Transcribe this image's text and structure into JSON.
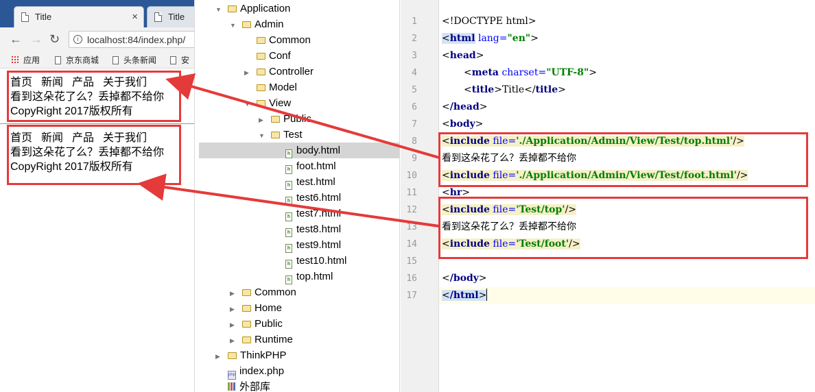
{
  "browser": {
    "tabs": [
      {
        "title": "Title",
        "close": "×"
      },
      {
        "title": "Title"
      }
    ],
    "url": "localhost:84/index.php/",
    "bookmarks": [
      "应用",
      "京东商城",
      "头条新闻",
      "安"
    ],
    "page_blocks": [
      {
        "nav": [
          "首页",
          "新闻",
          "产品",
          "关于我们"
        ],
        "text": "看到这朵花了么？丢掉都不给你",
        "footer": "CopyRight 2017版权所有"
      },
      {
        "nav": [
          "首页",
          "新闻",
          "产品",
          "关于我们"
        ],
        "text": "看到这朵花了么？丢掉都不给你",
        "footer": "CopyRight 2017版权所有"
      }
    ]
  },
  "tree": {
    "items": [
      {
        "label": "Application",
        "expanded": true,
        "icon": "folder-icon"
      },
      {
        "label": "Admin",
        "expanded": true,
        "icon": "folder-icon"
      },
      {
        "label": "Common",
        "icon": "folder-icon"
      },
      {
        "label": "Conf",
        "icon": "folder-icon"
      },
      {
        "label": "Controller",
        "expanded": false,
        "icon": "folder-icon"
      },
      {
        "label": "Model",
        "icon": "folder-icon"
      },
      {
        "label": "View",
        "expanded": true,
        "icon": "folder-icon"
      },
      {
        "label": "Public",
        "expanded": false,
        "icon": "folder-icon"
      },
      {
        "label": "Test",
        "expanded": true,
        "icon": "folder-icon"
      },
      {
        "label": "body.html",
        "icon": "html-file-icon",
        "selected": true
      },
      {
        "label": "foot.html",
        "icon": "html-file-icon"
      },
      {
        "label": "test.html",
        "icon": "html-file-icon"
      },
      {
        "label": "test6.html",
        "icon": "html-file-icon"
      },
      {
        "label": "test7.html",
        "icon": "html-file-icon"
      },
      {
        "label": "test8.html",
        "icon": "html-file-icon"
      },
      {
        "label": "test9.html",
        "icon": "html-file-icon"
      },
      {
        "label": "test10.html",
        "icon": "html-file-icon"
      },
      {
        "label": "top.html",
        "icon": "html-file-icon"
      },
      {
        "label": "Common",
        "expanded": false,
        "icon": "folder-icon"
      },
      {
        "label": "Home",
        "expanded": false,
        "icon": "folder-icon"
      },
      {
        "label": "Public",
        "expanded": false,
        "icon": "folder-icon"
      },
      {
        "label": "Runtime",
        "expanded": false,
        "icon": "folder-icon"
      },
      {
        "label": "ThinkPHP",
        "expanded": false,
        "icon": "folder-icon"
      },
      {
        "label": "index.php",
        "icon": "php-file-icon"
      },
      {
        "label": "外部库",
        "icon": "library-icon"
      }
    ]
  },
  "editor": {
    "line_numbers": [
      "1",
      "2",
      "3",
      "4",
      "5",
      "6",
      "7",
      "8",
      "9",
      "10",
      "11",
      "12",
      "13",
      "14",
      "15",
      "16",
      "17"
    ],
    "code": {
      "l1": "<!DOCTYPE html>",
      "l2_tag": "html",
      "l2_attr": " lang=",
      "l2_val": "\"en\"",
      "l3_tag": "head",
      "l4_tag": "meta",
      "l4_attr": " charset=",
      "l4_val": "\"UTF-8\"",
      "l5_tag": "title",
      "l5_text": "Title",
      "l6_tag": "/head",
      "l7_tag": "body",
      "l8_tag": "include",
      "l8_attr": " file=",
      "l8_val": "'./Application/Admin/View/Test/top.html'",
      "l9_text": "看到这朵花了么？丢掉都不给你",
      "l10_tag": "include",
      "l10_attr": " file=",
      "l10_val": "'./Application/Admin/View/Test/foot.html'",
      "l11_tag": "hr",
      "l12_tag": "include",
      "l12_attr": " file=",
      "l12_val": "'Test/top'",
      "l13_text": "看到这朵花了么？丢掉都不给你",
      "l14_tag": "include",
      "l14_attr": " file=",
      "l14_val": "'Test/foot'",
      "l16_tag": "/body",
      "l17_tag": "/html"
    }
  },
  "colors": {
    "annotation": "#e53a3a",
    "tag": "#000080",
    "string": "#008000",
    "attr": "#0000ff"
  }
}
